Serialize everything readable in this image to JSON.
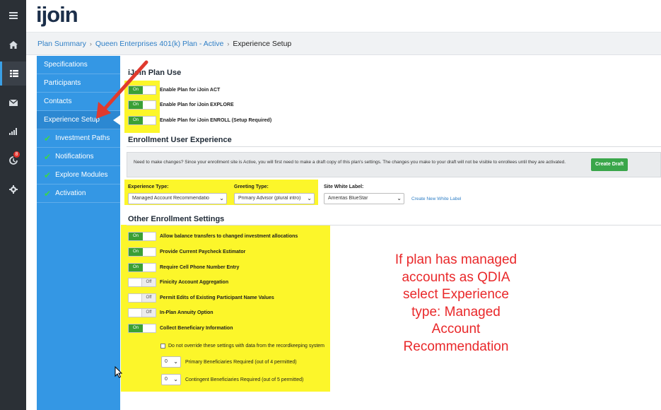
{
  "app": {
    "logo": "ijoin"
  },
  "rail": {
    "menu_icon": "hamburger-icon",
    "items": [
      {
        "icon": "home-icon"
      },
      {
        "icon": "list-icon"
      },
      {
        "icon": "mail-icon"
      },
      {
        "icon": "bar-chart-icon"
      },
      {
        "icon": "alert-icon",
        "badge": "8"
      },
      {
        "icon": "gear-icon"
      }
    ]
  },
  "breadcrumb": {
    "items": [
      "Plan Summary",
      "Queen Enterprises 401(k) Plan - Active"
    ],
    "separator": "›",
    "current": "Experience Setup"
  },
  "leftnav": {
    "items": [
      {
        "label": "Specifications",
        "checked": false
      },
      {
        "label": "Participants",
        "checked": false
      },
      {
        "label": "Contacts",
        "checked": false
      },
      {
        "label": "Experience Setup",
        "checked": false,
        "selected": true
      },
      {
        "label": "Investment Paths",
        "checked": true
      },
      {
        "label": "Notifications",
        "checked": true
      },
      {
        "label": "Explore Modules",
        "checked": true
      },
      {
        "label": "Activation",
        "checked": true
      }
    ],
    "check_glyph": "✔"
  },
  "plan_use": {
    "title": "iJoin Plan Use",
    "toggles": [
      {
        "label": "Enable Plan for iJoin ACT",
        "state": "On"
      },
      {
        "label": "Enable Plan for iJoin EXPLORE",
        "state": "On"
      },
      {
        "label": "Enable Plan for iJoin ENROLL (Setup Required)",
        "state": "On"
      }
    ]
  },
  "enrollment_ux": {
    "title": "Enrollment User Experience",
    "notice": "Need to make changes? Since your enrollment site is Active, you will first need to make a draft copy of this plan's settings. The changes you make to your draft will not be visible to enrollees until they are activated.",
    "create_draft": "Create Draft",
    "experience_type": {
      "label": "Experience Type:",
      "value": "Managed Account Recommendatio"
    },
    "greeting_type": {
      "label": "Greeting Type:",
      "value": "Primary Advisor (plural intro)"
    },
    "white_label": {
      "label": "Site White Label:",
      "value": "Ameritas BlueStar"
    },
    "create_white_label": "Create New White Label"
  },
  "other_settings": {
    "title": "Other Enrollment Settings",
    "toggles": [
      {
        "label": "Allow balance transfers to changed investment allocations",
        "state": "On"
      },
      {
        "label": "Provide Current Paycheck Estimator",
        "state": "On"
      },
      {
        "label": "Require Cell Phone Number Entry",
        "state": "On"
      },
      {
        "label": "Finicity Account Aggregation",
        "state": "Off"
      },
      {
        "label": "Permit Edits of Existing Participant Name Values",
        "state": "Off"
      },
      {
        "label": "In-Plan Annuity Option",
        "state": "Off"
      },
      {
        "label": "Collect Beneficiary Information",
        "state": "On"
      }
    ],
    "override_checkbox": "Do not override these settings with data from the recordkeeping system",
    "primary_beneficiaries": {
      "value": "0",
      "label": "Primary Beneficiaries Required (out of 4 permitted)"
    },
    "contingent_beneficiaries": {
      "value": "0",
      "label": "Contingent Beneficiaries Required (out of 5 permitted)"
    }
  },
  "annotation": {
    "lines": [
      "If plan has managed",
      "accounts as QDIA",
      "select Experience",
      "type:  Managed",
      "Account",
      "Recommendation"
    ],
    "color": "#e9282a"
  },
  "colors": {
    "nav_blue": "#3497e4",
    "highlight": "#fcf62a",
    "toggle_on": "#3aa035",
    "rail": "#2b3036",
    "arrow": "#e03a2e"
  }
}
